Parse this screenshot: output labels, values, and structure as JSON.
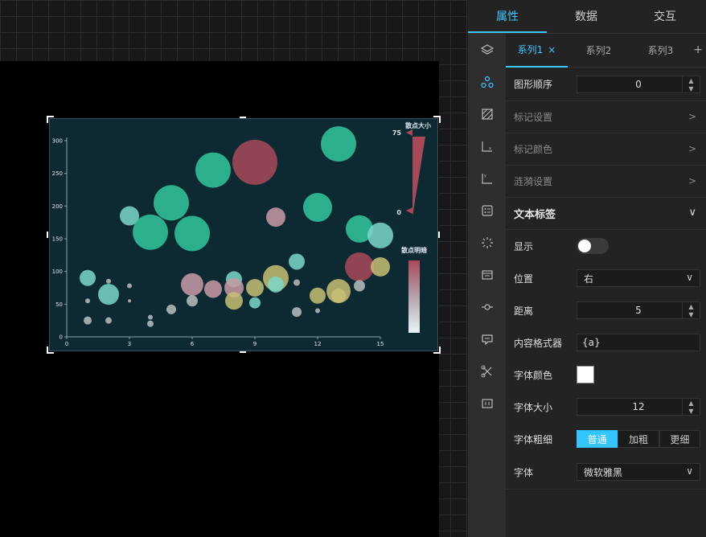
{
  "panel": {
    "tabs": [
      "属性",
      "数据",
      "交互"
    ],
    "series_tabs": [
      "系列1",
      "系列2",
      "系列3"
    ],
    "close_mark": "×",
    "add_mark": "+",
    "shape_order": {
      "label": "图形顺序",
      "value": "0"
    },
    "collapsed_sections": [
      "标记设置",
      "标记颜色",
      "涟漪设置"
    ],
    "text_label": {
      "title": "文本标签",
      "show_label": "显示",
      "show_value": false,
      "position_label": "位置",
      "position_value": "右",
      "distance_label": "距离",
      "distance_value": "5",
      "formatter_label": "内容格式器",
      "formatter_value": "{a}",
      "font_color_label": "字体颜色",
      "font_color_value": "#ffffff",
      "font_size_label": "字体大小",
      "font_size_value": "12",
      "font_weight_label": "字体粗细",
      "font_weight_options": [
        "普通",
        "加粗",
        "更细"
      ],
      "font_weight_selected": "普通",
      "font_family_label": "字体",
      "font_family_value": "微软雅黑"
    }
  },
  "chart_data": {
    "type": "scatter",
    "title": "",
    "xlim": [
      0,
      15
    ],
    "ylim": [
      0,
      300
    ],
    "xticks": [
      "0",
      "3",
      "6",
      "9",
      "12",
      "15"
    ],
    "yticks": [
      "0",
      "50",
      "100",
      "150",
      "200",
      "250",
      "300"
    ],
    "colors": {
      "green": "#33c79e",
      "red": "#a8495a",
      "yellow": "#c8bf74",
      "pink": "#c99aa6",
      "mint": "#7ad8c8",
      "gray": "#b8c0c0"
    },
    "size_legend": {
      "title": "散点大小",
      "max_label": "75",
      "min_label": "0"
    },
    "color_legend": {
      "title": "散点明暗"
    },
    "points": [
      {
        "x": 1,
        "y": 90,
        "r": 10,
        "c": "mint"
      },
      {
        "x": 1,
        "y": 55,
        "r": 3,
        "c": "gray"
      },
      {
        "x": 1,
        "y": 25,
        "r": 5,
        "c": "gray"
      },
      {
        "x": 2,
        "y": 85,
        "r": 3,
        "c": "gray"
      },
      {
        "x": 2,
        "y": 65,
        "r": 13,
        "c": "mint"
      },
      {
        "x": 2,
        "y": 25,
        "r": 4,
        "c": "gray"
      },
      {
        "x": 3,
        "y": 185,
        "r": 12,
        "c": "mint"
      },
      {
        "x": 3,
        "y": 78,
        "r": 3,
        "c": "gray"
      },
      {
        "x": 3,
        "y": 55,
        "r": 2,
        "c": "gray"
      },
      {
        "x": 4,
        "y": 160,
        "r": 22,
        "c": "green"
      },
      {
        "x": 4,
        "y": 30,
        "r": 3,
        "c": "gray"
      },
      {
        "x": 4,
        "y": 20,
        "r": 4,
        "c": "gray"
      },
      {
        "x": 5,
        "y": 205,
        "r": 22,
        "c": "green"
      },
      {
        "x": 5,
        "y": 42,
        "r": 6,
        "c": "gray"
      },
      {
        "x": 6,
        "y": 158,
        "r": 22,
        "c": "green"
      },
      {
        "x": 6,
        "y": 80,
        "r": 14,
        "c": "pink"
      },
      {
        "x": 6,
        "y": 55,
        "r": 7,
        "c": "gray"
      },
      {
        "x": 7,
        "y": 255,
        "r": 22,
        "c": "green"
      },
      {
        "x": 7,
        "y": 73,
        "r": 11,
        "c": "pink"
      },
      {
        "x": 8,
        "y": 88,
        "r": 10,
        "c": "mint"
      },
      {
        "x": 8,
        "y": 75,
        "r": 12,
        "c": "pink"
      },
      {
        "x": 8,
        "y": 55,
        "r": 11,
        "c": "yellow"
      },
      {
        "x": 9,
        "y": 267,
        "r": 28,
        "c": "red"
      },
      {
        "x": 9,
        "y": 75,
        "r": 11,
        "c": "yellow"
      },
      {
        "x": 9,
        "y": 52,
        "r": 7,
        "c": "mint"
      },
      {
        "x": 10,
        "y": 183,
        "r": 12,
        "c": "pink"
      },
      {
        "x": 10,
        "y": 90,
        "r": 16,
        "c": "yellow"
      },
      {
        "x": 10,
        "y": 80,
        "r": 10,
        "c": "mint"
      },
      {
        "x": 11,
        "y": 115,
        "r": 10,
        "c": "mint"
      },
      {
        "x": 11,
        "y": 83,
        "r": 4,
        "c": "gray"
      },
      {
        "x": 11,
        "y": 38,
        "r": 6,
        "c": "gray"
      },
      {
        "x": 12,
        "y": 198,
        "r": 18,
        "c": "green"
      },
      {
        "x": 12,
        "y": 63,
        "r": 10,
        "c": "yellow"
      },
      {
        "x": 12,
        "y": 40,
        "r": 3,
        "c": "gray"
      },
      {
        "x": 13,
        "y": 295,
        "r": 22,
        "c": "green"
      },
      {
        "x": 13,
        "y": 70,
        "r": 15,
        "c": "yellow"
      },
      {
        "x": 13,
        "y": 63,
        "r": 9,
        "c": "yellow"
      },
      {
        "x": 14,
        "y": 165,
        "r": 17,
        "c": "green"
      },
      {
        "x": 14,
        "y": 107,
        "r": 18,
        "c": "red"
      },
      {
        "x": 14,
        "y": 78,
        "r": 7,
        "c": "gray"
      },
      {
        "x": 15,
        "y": 155,
        "r": 16,
        "c": "mint"
      },
      {
        "x": 15,
        "y": 107,
        "r": 12,
        "c": "yellow"
      }
    ]
  }
}
